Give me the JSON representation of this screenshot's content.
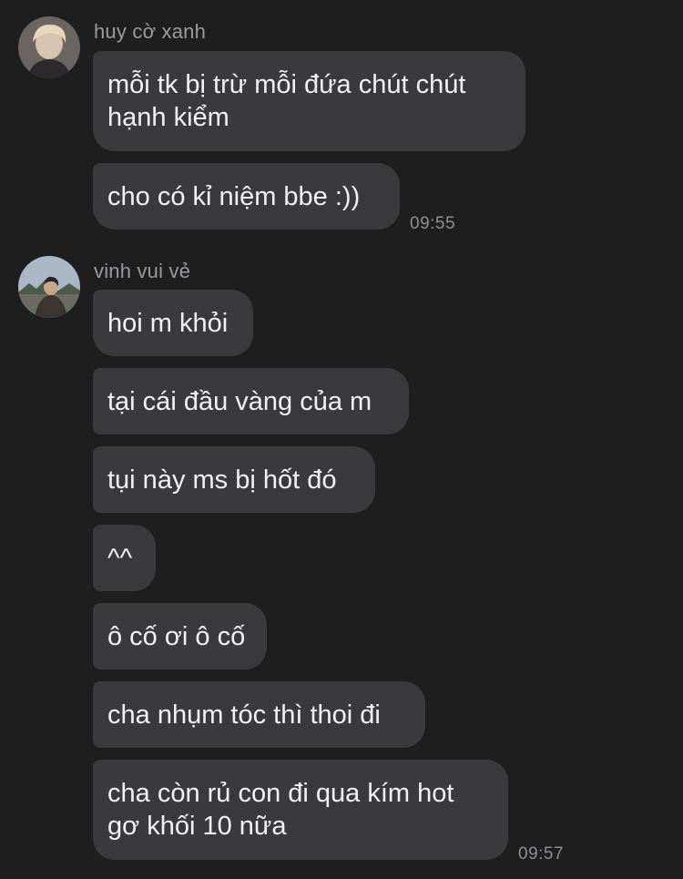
{
  "messages": {
    "group1": {
      "sender": "huy cờ xanh",
      "avatar_icon": "user-avatar-blonde",
      "bubbles": [
        "mỗi tk bị trừ mỗi đứa chút chút\nhạnh kiểm",
        "cho có kỉ niệm bbe :))"
      ],
      "time": "09:55"
    },
    "group2": {
      "sender": "vinh vui vẻ",
      "avatar_icon": "user-avatar-outdoor",
      "bubbles": [
        "hoi m khỏi",
        "tại cái đầu vàng của m",
        "tụi này ms bị hốt đó",
        "^^",
        "ô cố ơi ô cố",
        "cha nhụm tóc thì thoi đi",
        "cha còn rủ con đi qua kím hot\ngơ khối 10 nữa"
      ],
      "time": "09:57"
    }
  },
  "colors": {
    "background": "#1e1e1f",
    "bubble": "#3a3a3c",
    "text": "#f2f2f4",
    "meta": "#8e8e93"
  }
}
